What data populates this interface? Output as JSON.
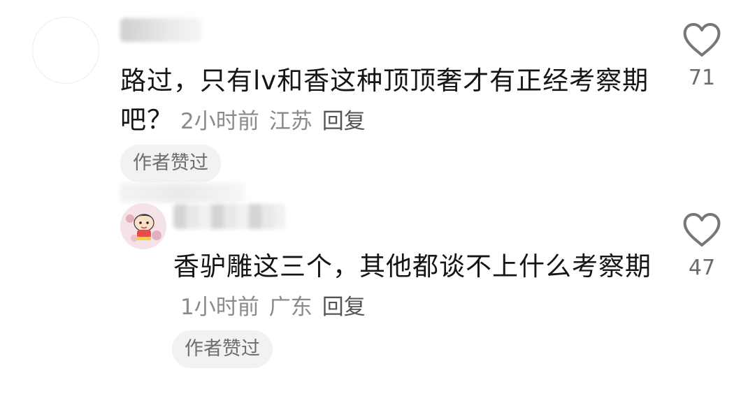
{
  "comments": [
    {
      "text": "路过，只有lv和香这种顶顶奢才有正经考察期吧？",
      "time": "2小时前",
      "location": "江苏",
      "reply_label": "回复",
      "author_badge": "作者赞过",
      "likes": "71",
      "avatar_icon": "blank-avatar"
    },
    {
      "text": "香驴雕这三个，其他都谈不上什么考察期",
      "time": "1小时前",
      "location": "广东",
      "reply_label": "回复",
      "author_badge": "作者赞过",
      "likes": "47",
      "avatar_icon": "cartoon-boy-avatar"
    }
  ],
  "icons": {
    "like": "heart-outline-icon"
  },
  "colors": {
    "text": "#151515",
    "meta": "#8a8a8a",
    "badge_bg": "#f2f2f2"
  }
}
